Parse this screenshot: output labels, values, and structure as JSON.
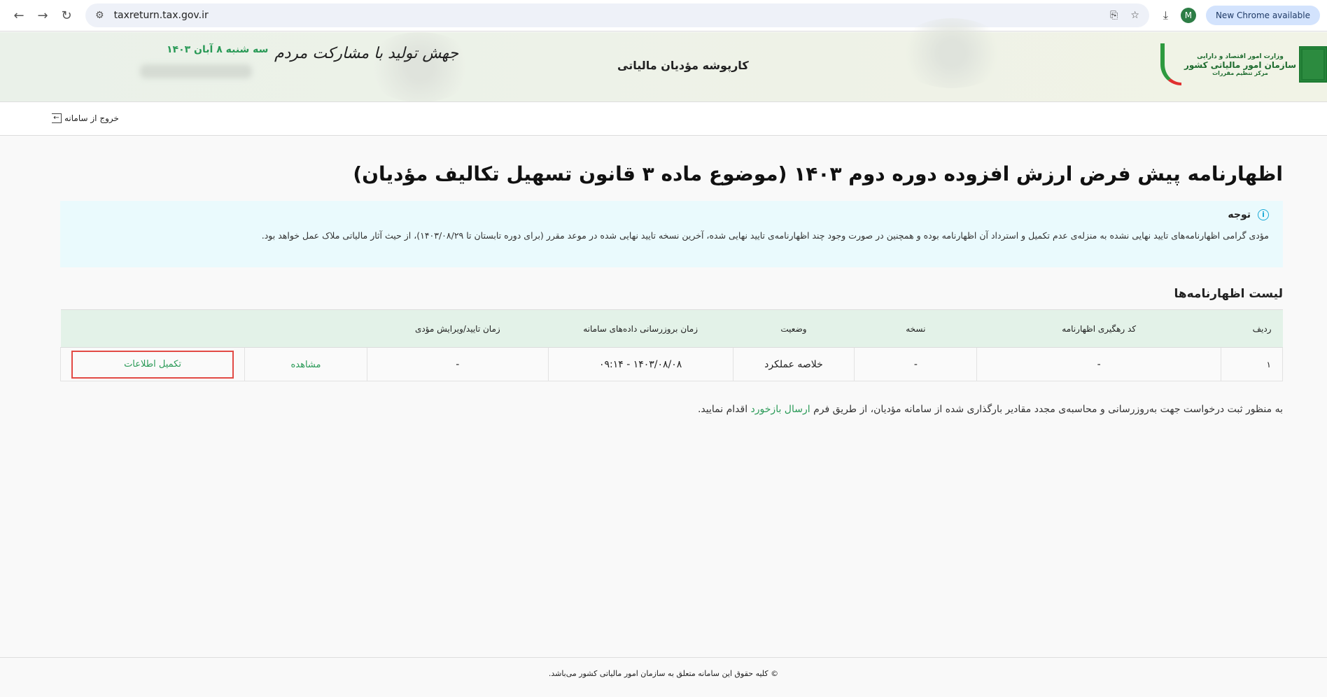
{
  "browser": {
    "url": "taxreturn.tax.gov.ir",
    "avatar_letter": "M",
    "new_chrome": "New Chrome available"
  },
  "header": {
    "title": "کارپوشه مؤدیان مالیاتی",
    "slogan": "جهش تولید با مشارکت مردم",
    "date": "سه شنبه ۸ آبان ۱۴۰۳",
    "logo": {
      "line1": "وزارت امور اقتصاد و دارایی",
      "line2": "سازمان امور مالیاتی کشور",
      "line3": "مرکز تنظیم مقررات"
    }
  },
  "nav": {
    "logout": "خروج از سامانه"
  },
  "page": {
    "title": "اظهارنامه پیش فرض ارزش افزوده دوره دوم ۱۴۰۳ (موضوع ماده ۳ قانون تسهیل تکالیف مؤدیان)"
  },
  "alert": {
    "title": "توجه",
    "text": "مؤدی گرامی اظهارنامه‌های تایید نهایی نشده به منزله‌ی عدم تکمیل و استرداد آن اظهارنامه بوده و همچنین در صورت وجود چند اظهارنامه‌ی تایید نهایی شده، آخرین نسخه تایید نهایی شده در موعد مقرر (برای دوره تابستان تا ۱۴۰۳/۰۸/۲۹)، از حیث آثار مالیاتی ملاک عمل خواهد بود."
  },
  "list": {
    "title": "لیست اظهارنامه‌ها",
    "columns": [
      "ردیف",
      "کد رهگیری اظهارنامه",
      "نسخه",
      "وضعیت",
      "زمان بروزرسانی داده‌های سامانه",
      "زمان تایید/ویرایش مؤدی",
      "",
      ""
    ],
    "rows": [
      {
        "index": "۱",
        "tracking": "-",
        "version": "-",
        "status": "خلاصه عملکرد",
        "updated": "۱۴۰۳/۰۸/۰۸ - ۰۹:۱۴",
        "confirmed": "-",
        "view": "مشاهده",
        "complete": "تکمیل اطلاعات"
      }
    ]
  },
  "note": {
    "before": "به منظور ثبت درخواست جهت به‌روزرسانی و محاسبه‌ی مجدد مقادیر بارگذاری شده از سامانه مؤدیان، از طریق فرم",
    "link": "ارسال بازخورد",
    "after": "اقدام نمایید."
  },
  "footer": {
    "text": "© کلیه حقوق این سامانه متعلق به سازمان امور مالیاتی کشور می‌باشد."
  }
}
